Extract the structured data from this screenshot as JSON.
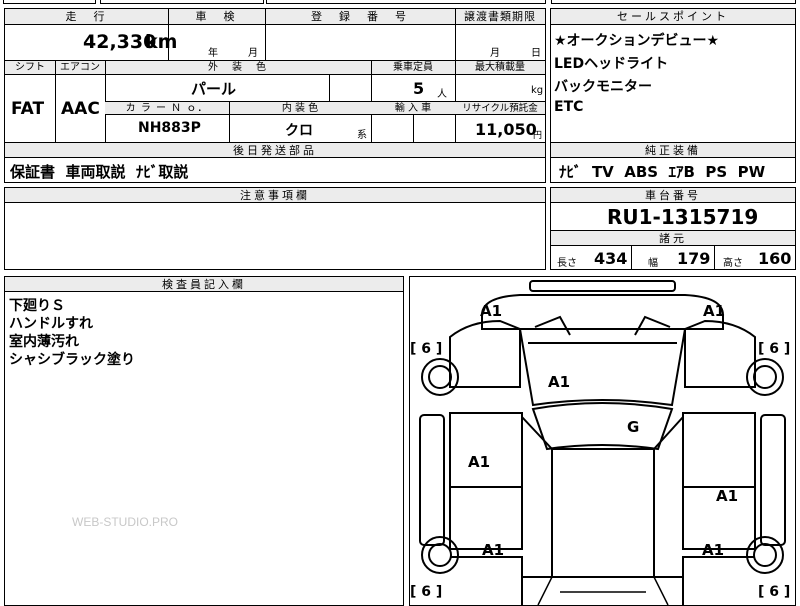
{
  "top": {
    "mileage_header": "走　行",
    "mileage_value": "42,330",
    "mileage_unit": "km",
    "inspection_header": "車　検",
    "inspection_year": "年",
    "inspection_month": "月",
    "registration_header": "登　録　番　号",
    "transfer_header": "譲渡書類期限",
    "transfer_month": "月",
    "transfer_day": "日"
  },
  "specs": {
    "shift_header": "シフト",
    "ac_header": "エアコン",
    "exterior_header": "外　装　色",
    "capacity_header": "乗車定員",
    "max_load_header": "最大積載量",
    "shift_value": "FAT",
    "ac_value": "AAC",
    "exterior_value": "パール",
    "capacity_value": "5",
    "capacity_unit": "人",
    "max_load_unit": "kg",
    "color_no_header": "カ ラ ー Ｎ ｏ．",
    "interior_header": "内 装 色",
    "import_header": "輸 入 車",
    "recycle_header": "リサイクル預託金",
    "color_no_value": "NH883P",
    "interior_value": "クロ",
    "interior_suffix": "系",
    "recycle_value": "11,050",
    "recycle_unit": "円"
  },
  "sales_points": {
    "header": "セールスポイント",
    "lines": [
      "★オークションデビュー★",
      "LEDヘッドライト",
      "バックモニター",
      "ETC"
    ]
  },
  "later_parts": {
    "header": "後日発送部品",
    "value": "保証書  車両取説  ﾅﾋﾞ取説"
  },
  "equipment": {
    "header": "純正装備",
    "value": "ﾅﾋﾞ  TV  ABS  ｴｱB  PS  PW"
  },
  "notes": {
    "header": "注意事項欄"
  },
  "chassis": {
    "header": "車台番号",
    "value": "RU1-1315719"
  },
  "dimensions": {
    "header": "諸元",
    "length_label": "長さ",
    "length_value": "434",
    "width_label": "幅",
    "width_value": "179",
    "height_label": "高さ",
    "height_value": "160"
  },
  "inspector": {
    "header": "検査員記入欄",
    "lines": [
      "下廻りＳ",
      "ハンドルすれ",
      "室内薄汚れ",
      "シャシブラック塗り"
    ]
  },
  "diagram": {
    "marks": {
      "front_left": "A1",
      "front_right": "A1",
      "hood": "A1",
      "windshield": "G",
      "left_front_door": "A1",
      "right_rear_door": "A1",
      "rear_left": "A1",
      "rear_right": "A1"
    },
    "tread": {
      "front_left": "[ 6 ]",
      "front_right": "[ 6 ]",
      "rear_left": "[ 6 ]",
      "rear_right": "[ 6 ]"
    }
  },
  "watermark": "WEB-STUDIO.PRO"
}
